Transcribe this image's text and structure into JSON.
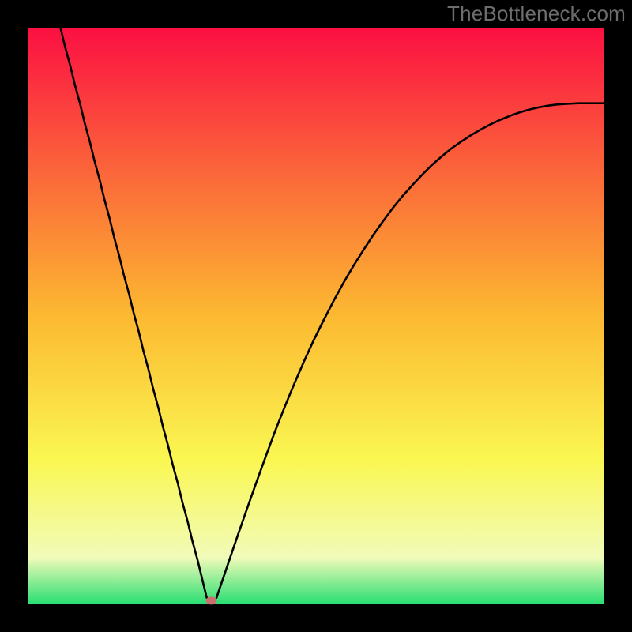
{
  "watermark": "TheBottleneck.com",
  "chart_data": {
    "type": "line",
    "title": "",
    "xlabel": "",
    "ylabel": "",
    "xlim": [
      0,
      100
    ],
    "ylim": [
      0,
      100
    ],
    "grid": false,
    "legend": false,
    "background_gradient": {
      "direction": "vertical",
      "stops": [
        {
          "offset": 0.0,
          "color": "#fb1042"
        },
        {
          "offset": 0.25,
          "color": "#fb663a"
        },
        {
          "offset": 0.5,
          "color": "#fcb931"
        },
        {
          "offset": 0.75,
          "color": "#faf752"
        },
        {
          "offset": 0.92,
          "color": "#f1fbb9"
        },
        {
          "offset": 1.0,
          "color": "#2bdf73"
        }
      ]
    },
    "series": [
      {
        "name": "left-branch",
        "style": "line",
        "x": [
          5.6,
          6.4,
          7.3,
          8.1,
          9.0,
          9.8,
          10.7,
          11.5,
          12.4,
          13.2,
          14.1,
          14.9,
          15.8,
          16.6,
          17.5,
          18.3,
          19.2,
          20.0,
          20.9,
          21.7,
          22.6,
          23.4,
          24.3,
          25.1,
          26.0,
          26.8,
          27.7,
          28.5,
          29.4,
          30.2,
          31.0
        ],
        "y": [
          100.0,
          96.7,
          93.4,
          90.1,
          86.8,
          83.5,
          80.2,
          76.9,
          73.6,
          70.3,
          67.0,
          63.7,
          60.4,
          57.1,
          53.8,
          50.5,
          47.2,
          43.9,
          40.6,
          37.3,
          34.0,
          30.7,
          27.4,
          24.1,
          20.8,
          17.5,
          14.2,
          10.9,
          7.6,
          4.3,
          1.0
        ]
      },
      {
        "name": "right-branch",
        "style": "line",
        "x": [
          32.7,
          34.4,
          36.1,
          37.8,
          39.5,
          41.2,
          42.9,
          44.6,
          46.3,
          48.0,
          49.7,
          51.4,
          53.1,
          54.8,
          56.5,
          58.2,
          59.9,
          61.6,
          63.3,
          65.0,
          66.7,
          68.4,
          70.1,
          71.8,
          73.5,
          75.2,
          76.9,
          78.6,
          80.3,
          82.0,
          83.7,
          85.4,
          87.1,
          88.8,
          90.5,
          92.2,
          93.9,
          95.6,
          97.3,
          99.0,
          100.0
        ],
        "y": [
          1.0,
          6.0,
          11.0,
          15.9,
          20.7,
          25.4,
          30.0,
          34.3,
          38.4,
          42.3,
          46.0,
          49.4,
          52.7,
          55.8,
          58.7,
          61.4,
          64.0,
          66.4,
          68.7,
          70.8,
          72.7,
          74.5,
          76.2,
          77.7,
          79.1,
          80.3,
          81.4,
          82.4,
          83.3,
          84.1,
          84.8,
          85.4,
          85.9,
          86.3,
          86.6,
          86.8,
          86.9,
          87.0,
          87.0,
          87.0,
          87.0
        ]
      },
      {
        "name": "minimum-marker",
        "style": "marker",
        "x": [
          31.8
        ],
        "y": [
          0.5
        ],
        "marker_color": "#c97171",
        "marker_rx": 7,
        "marker_ry": 5
      }
    ]
  }
}
